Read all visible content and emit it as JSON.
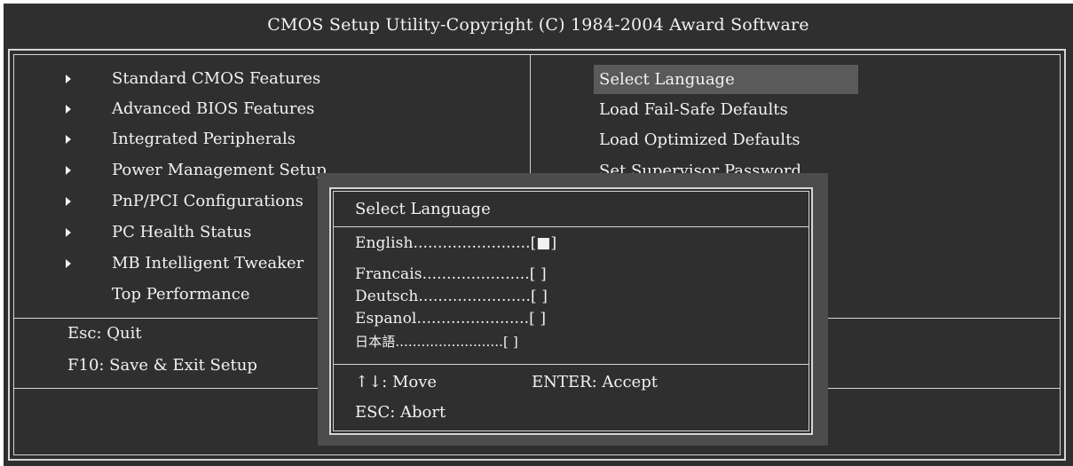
{
  "title": "CMOS Setup Utility-Copyright (C) 1984-2004 Award Software",
  "left_menu": [
    {
      "label": "Standard CMOS Features",
      "submenu": true
    },
    {
      "label": "Advanced BIOS Features",
      "submenu": true
    },
    {
      "label": "Integrated Peripherals",
      "submenu": true
    },
    {
      "label": "Power Management Setup",
      "submenu": true
    },
    {
      "label": "PnP/PCI Configurations",
      "submenu": true
    },
    {
      "label": "PC Health Status",
      "submenu": true
    },
    {
      "label": "MB Intelligent Tweaker",
      "submenu": true
    },
    {
      "label": "Top Performance",
      "submenu": false
    }
  ],
  "right_menu": [
    {
      "label": "Select Language",
      "selected": true
    },
    {
      "label": "Load Fail-Safe Defaults",
      "selected": false
    },
    {
      "label": "Load Optimized Defaults",
      "selected": false
    },
    {
      "label": "Set Supervisor Password",
      "selected": false
    }
  ],
  "bottom_keys": {
    "esc": "Esc: Quit",
    "f10": "F10: Save & Exit Setup"
  },
  "popup": {
    "title": "Select Language",
    "options": [
      {
        "label": "English",
        "dots": "........................",
        "mark": "[■]",
        "selected": true
      },
      {
        "label": "Francais",
        "dots": "......................",
        "mark": "[ ]",
        "selected": false
      },
      {
        "label": "Deutsch",
        "dots": ".......................",
        "mark": "[ ]",
        "selected": false
      },
      {
        "label": "Espanol",
        "dots": ".......................",
        "mark": "[ ]",
        "selected": false
      },
      {
        "label": "日本語",
        "dots": ".........................",
        "mark": "[ ]",
        "selected": false
      }
    ],
    "help_move": "↑↓: Move",
    "help_accept": "ENTER: Accept",
    "help_abort": "ESC: Abort"
  },
  "colors": {
    "background": "#2f2f2f",
    "foreground": "#f2f2f2",
    "highlight": "#5a5a5a",
    "popup_shadow": "#4c4c4c",
    "border": "#d6d6d6"
  }
}
